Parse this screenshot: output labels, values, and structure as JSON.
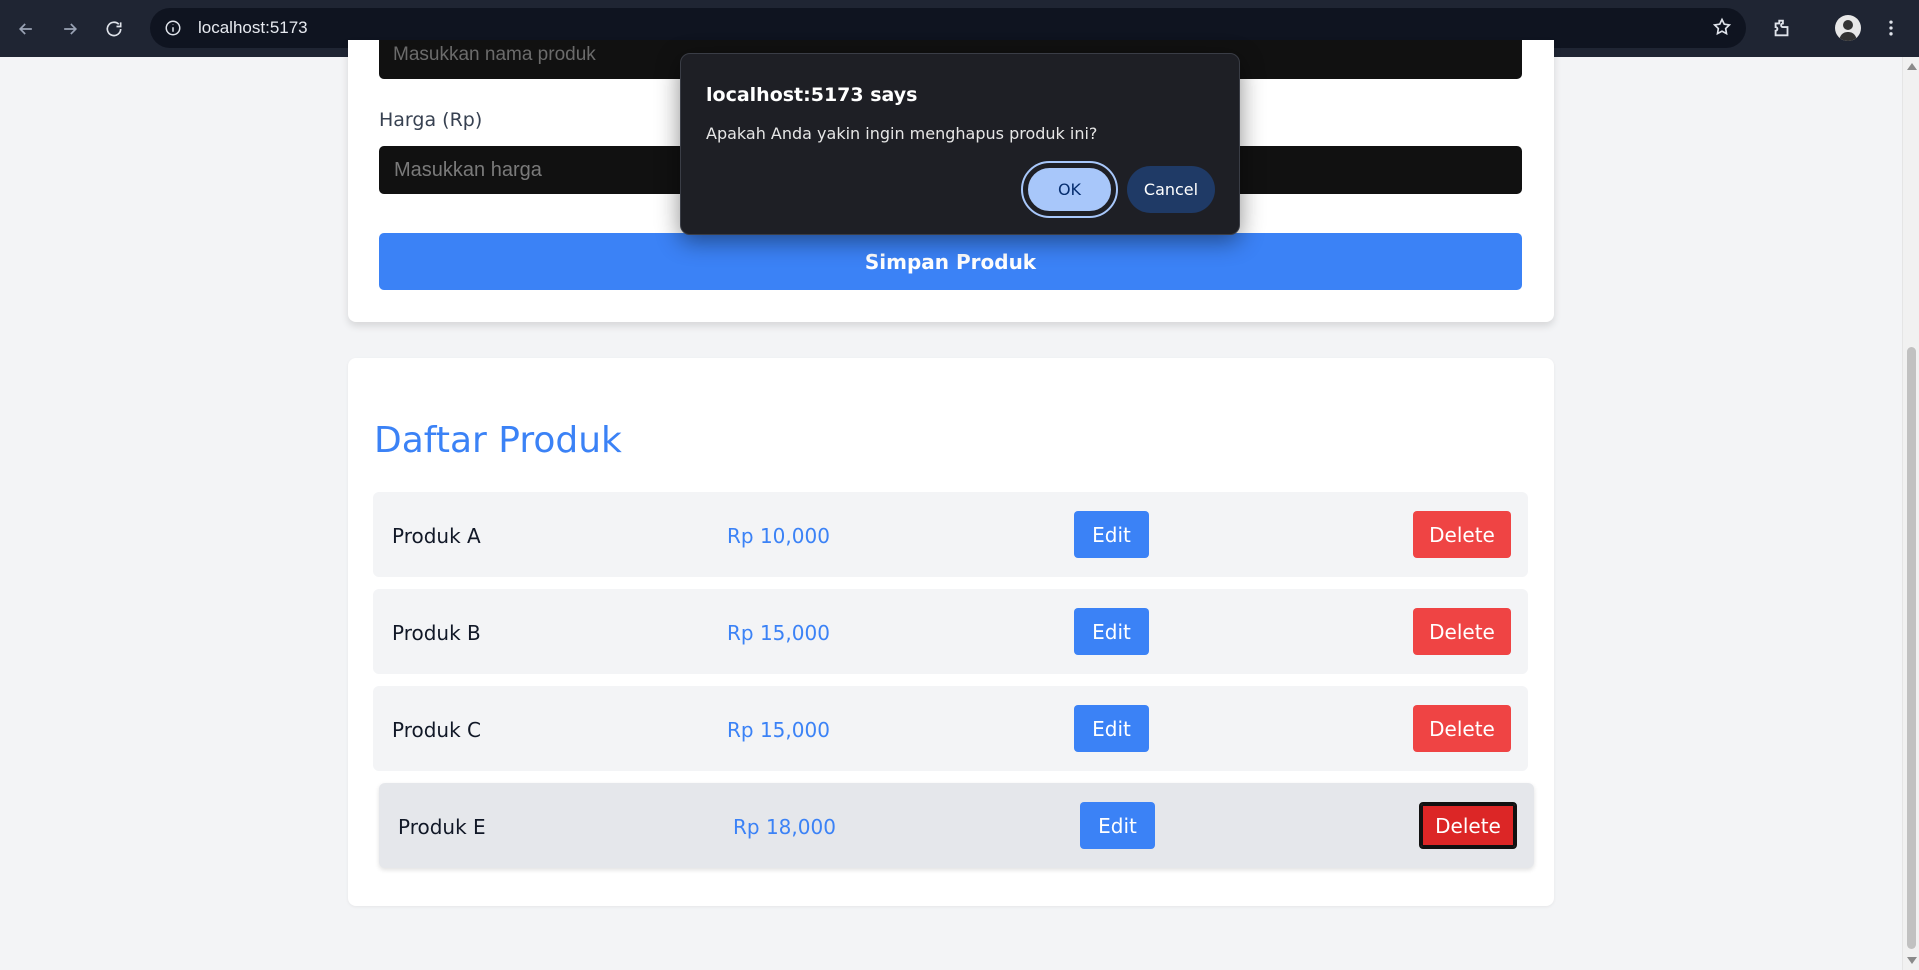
{
  "browser": {
    "url": "localhost:5173"
  },
  "form": {
    "name_placeholder": "Masukkan nama produk",
    "price_label": "Harga (Rp)",
    "price_placeholder": "Masukkan harga",
    "save_label": "Simpan Produk"
  },
  "list": {
    "title": "Daftar Produk",
    "edit_label": "Edit",
    "delete_label": "Delete",
    "items": [
      {
        "name": "Produk A",
        "price": "Rp 10,000"
      },
      {
        "name": "Produk B",
        "price": "Rp 15,000"
      },
      {
        "name": "Produk C",
        "price": "Rp 15,000"
      },
      {
        "name": "Produk E",
        "price": "Rp 18,000"
      }
    ]
  },
  "dialog": {
    "title": "localhost:5173 says",
    "message": "Apakah Anda yakin ingin menghapus produk ini?",
    "ok_label": "OK",
    "cancel_label": "Cancel"
  },
  "colors": {
    "primary": "#3b82f6",
    "danger": "#ef4444",
    "chrome": "#1f2533"
  }
}
